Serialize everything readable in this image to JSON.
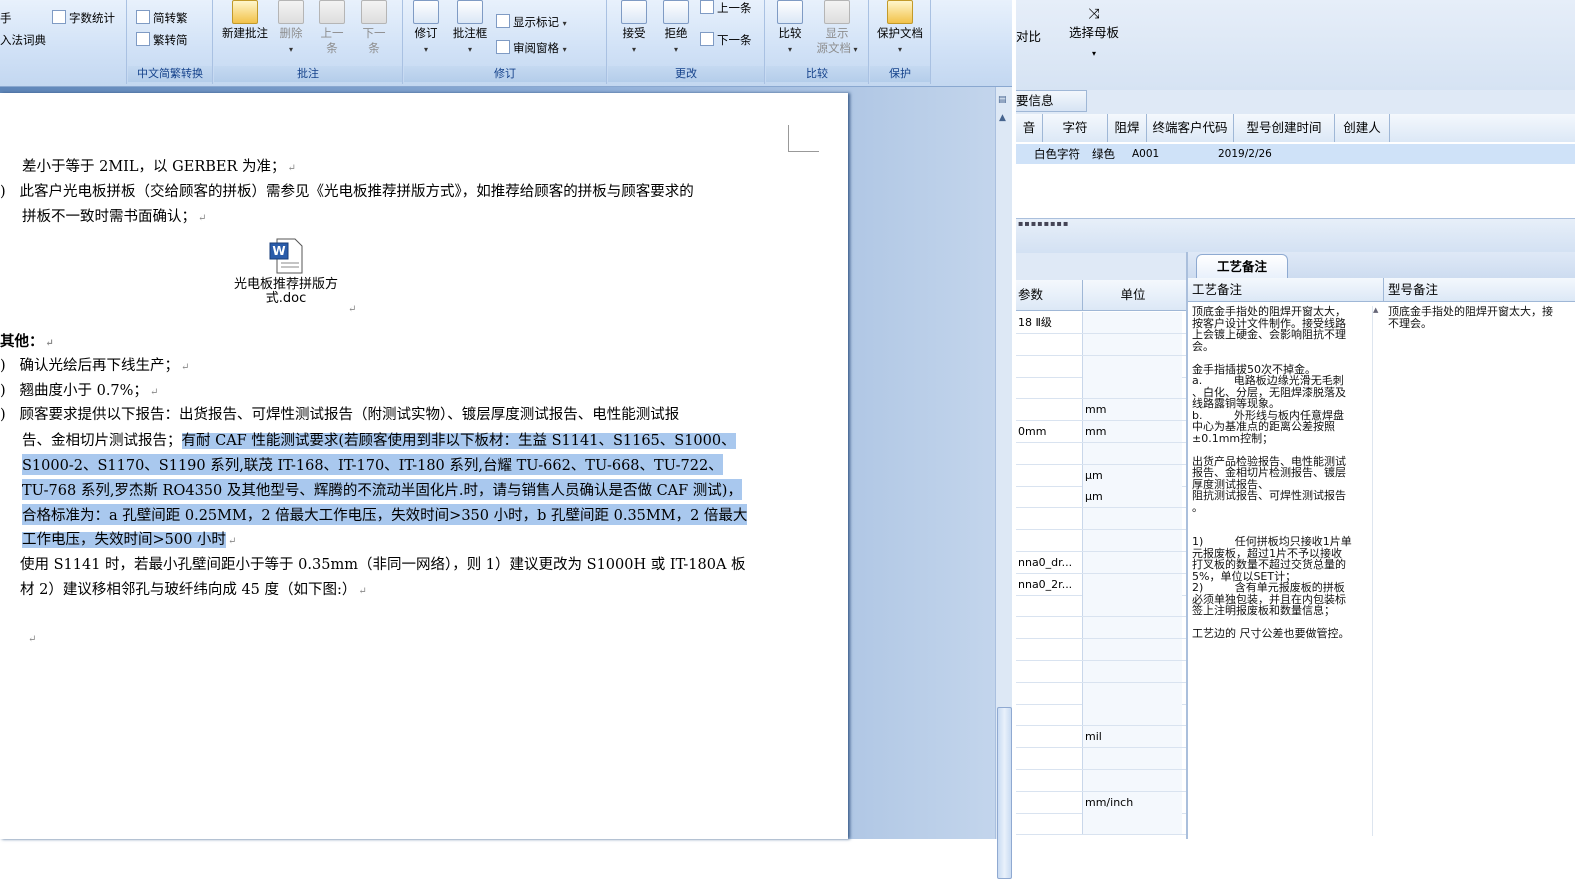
{
  "ribbon": {
    "left_items": [
      "手",
      "字数统计",
      "入法词典"
    ],
    "zh_items": [
      "简转繁",
      "繁转简"
    ],
    "groups": {
      "zh": "中文简繁转换",
      "comments": "批注",
      "revise": "修订",
      "changes": "更改",
      "compare": "比较",
      "protect": "保护"
    },
    "buttons": {
      "new_comment": "新建批注",
      "delete": "删除",
      "prev_a": "上一",
      "prev_b": "条",
      "next_a": "下一",
      "next_b": "条",
      "track": "修订",
      "balloon": "批注框",
      "show_markup": "显示标记",
      "review_pane": "审阅窗格",
      "accept": "接受",
      "reject": "拒绝",
      "prev_change": "上一条",
      "next_change": "下一条",
      "compare": "比较",
      "show_a": "显示",
      "show_b": "源文档",
      "protect": "保护文档"
    }
  },
  "document": {
    "line1": "差小于等于 2MIL，以 GERBER 为准；",
    "line2": "此客户光电板拼板（交给顾客的拼板）需参见《光电板推荐拼版方式》，如推荐给顾客的拼板与顾客要求的",
    "line3": "拼板不一致时需书面确认；",
    "object_label": "光电板推荐拼版方式.doc",
    "section": "其他：",
    "item1": "确认光绘后再下线生产；",
    "item2": "翘曲度小于 0.7%；",
    "item3a": "顾客要求提供以下报告：出货报告、可焊性测试报告（附测试实物）、镀层厚度测试报告、电性能测试报",
    "item3b_plain": "告、金相切片测试报告；",
    "item3b_hl": "有耐 CAF 性能测试要求(若顾客使用到非以下板材：生益 S1141、S1165、S1000、",
    "hl_line3": "S1000-2、S1170、S1190 系列,联茂 IT-168、IT-170、IT-180 系列,台耀 TU-662、TU-668、TU-722、",
    "hl_line4": "TU-768 系列,罗杰斯 RO4350 及其他型号、辉腾的不流动半固化片.时，请与销售人员确认是否做 CAF 测试)，",
    "hl_line5": "合格标准为：a 孔壁间距 0.25MM，2 倍最大工作电压，失效时间>350 小时，b 孔壁间距 0.35MM，2 倍最大",
    "hl_line6": "工作电压，失效时间>500 小时",
    "line_use": "使用 S1141 时，若最小孔壁间距小于等于 0.35mm（非同一网络），则 1）建议更改为 S1000H 或 IT-180A 板",
    "line_material": "材 2）建议移相邻孔与玻纤纬向成 45 度（如下图:）"
  },
  "app": {
    "top_btn1": "对比",
    "top_btn2": "选择母板",
    "section_title": "要信息",
    "columns": [
      "音",
      "字符",
      "阻焊",
      "终端客户代码",
      "型号创建时间",
      "创建人"
    ],
    "row": {
      "char": "白色字符",
      "solder": "绿色",
      "cust": "A001",
      "created": "2019/2/26",
      "creator": ""
    },
    "param_header": "参数",
    "unit_header": "单位",
    "params": [
      {
        "name": "18 Ⅱ级",
        "unit": ""
      },
      {
        "name": "",
        "unit": ""
      },
      {
        "name": "",
        "unit": ""
      },
      {
        "name": "",
        "unit": ""
      },
      {
        "name": "",
        "unit": "mm"
      },
      {
        "name": "0mm",
        "unit": "mm"
      },
      {
        "name": "",
        "unit": ""
      },
      {
        "name": "",
        "unit": "μm"
      },
      {
        "name": "",
        "unit": "μm"
      },
      {
        "name": "",
        "unit": ""
      },
      {
        "name": "",
        "unit": ""
      },
      {
        "name": "nna0_dr...",
        "unit": ""
      },
      {
        "name": "nna0_2r...",
        "unit": ""
      },
      {
        "name": "",
        "unit": ""
      },
      {
        "name": "",
        "unit": ""
      },
      {
        "name": "",
        "unit": ""
      },
      {
        "name": "",
        "unit": ""
      },
      {
        "name": "",
        "unit": ""
      },
      {
        "name": "",
        "unit": ""
      },
      {
        "name": "",
        "unit": "mil"
      },
      {
        "name": "",
        "unit": ""
      },
      {
        "name": "",
        "unit": ""
      },
      {
        "name": "",
        "unit": "mm/inch"
      },
      {
        "name": "",
        "unit": ""
      }
    ],
    "tab": "工艺备注",
    "memo_header1": "工艺备注",
    "memo_header2": "型号备注",
    "memo1": "顶底金手指处的阻焊开窗太大，\n按客户设计文件制作。接受线路\n上会镀上硬金、会影响阻抗不理\n会。\n\n金手指插拔50次不掉金。\na.         电路板边缘光滑无毛刺\n、白化、分层，无阻焊漆脱落及\n线路露铜等现象。\nb.         外形线与板内任意焊盘\n中心为基准点的距离公差按照\n±0.1mm控制；\n\n出货产品检验报告、电性能测试\n报告、金相切片检测报告、镀层\n厚度测试报告、\n阻抗测试报告、可焊性测试报告\n。\n\n\n1)         任何拼板均只接收1片单\n元报废板，超过1片不予以接收\n打叉板的数量不超过交货总量的\n5%，单位以SET计；\n2)         含有单元报废板的拼板\n必须单独包装，并且在内包装标\n签上注明报废板和数量信息；\n\n工艺边的 尺寸公差也要做管控。",
    "memo2": "顶底金手指处的阻焊开窗太大，接\n不理会。"
  }
}
